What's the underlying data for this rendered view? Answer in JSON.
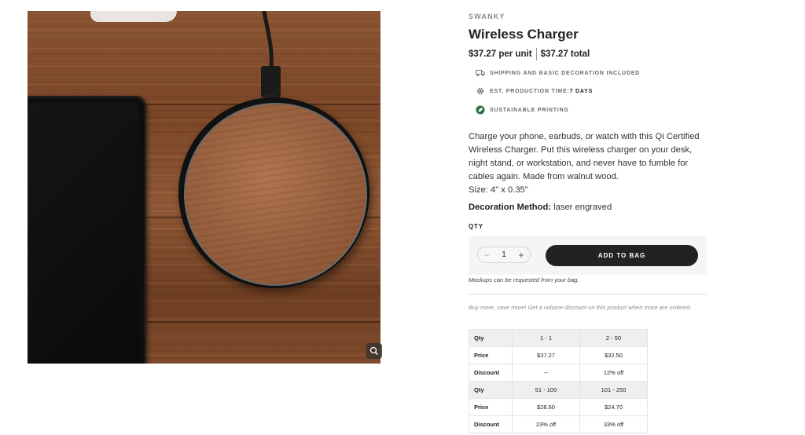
{
  "product": {
    "brand": "SWANKY",
    "title": "Wireless Charger",
    "price_unit": "$37.27 per unit",
    "price_total": "$37.27 total",
    "features": [
      {
        "icon": "truck-icon",
        "text": "SHIPPING AND BASIC DECORATION INCLUDED",
        "strong": ""
      },
      {
        "icon": "gear-icon",
        "text": "EST. PRODUCTION TIME: ",
        "strong": "7 DAYS"
      },
      {
        "icon": "leaf-icon",
        "text": "SUSTAINABLE PRINTING",
        "strong": ""
      }
    ],
    "description": "Charge your phone, earbuds, or watch with this Qi Certified Wireless Charger. Put this wireless charger on your desk, night stand, or workstation, and never have to fumble for cables again. Made from walnut wood.",
    "size": "Size: 4\" x 0.35\"",
    "decoration_label": "Decoration Method:",
    "decoration_value": " laser engraved"
  },
  "purchase": {
    "qty_label": "QTY",
    "qty_value": "1",
    "minus": "−",
    "plus": "+",
    "add_to_bag": "ADD TO BAG",
    "mockups_note": "Mockups can be requested from your bag.",
    "volume_note": "Buy more, save more! Get a volume discount on this product when more are ordered."
  },
  "pricing_table": {
    "groups": [
      {
        "qty_label": "Qty",
        "price_label": "Price",
        "discount_label": "Discount",
        "tiers": [
          {
            "range": "1 - 1",
            "price": "$37.27",
            "discount": "--"
          },
          {
            "range": "2 - 50",
            "price": "$32.50",
            "discount": "12% off"
          }
        ]
      },
      {
        "qty_label": "Qty",
        "price_label": "Price",
        "discount_label": "Discount",
        "tiers": [
          {
            "range": "51 - 100",
            "price": "$28.60",
            "discount": "23% off"
          },
          {
            "range": "101 - 250",
            "price": "$24.70",
            "discount": "33% off"
          }
        ]
      }
    ]
  },
  "colors": {
    "button": "#222222",
    "panel": "#f5f5f4",
    "leaf_badge": "#2e6b3c"
  }
}
